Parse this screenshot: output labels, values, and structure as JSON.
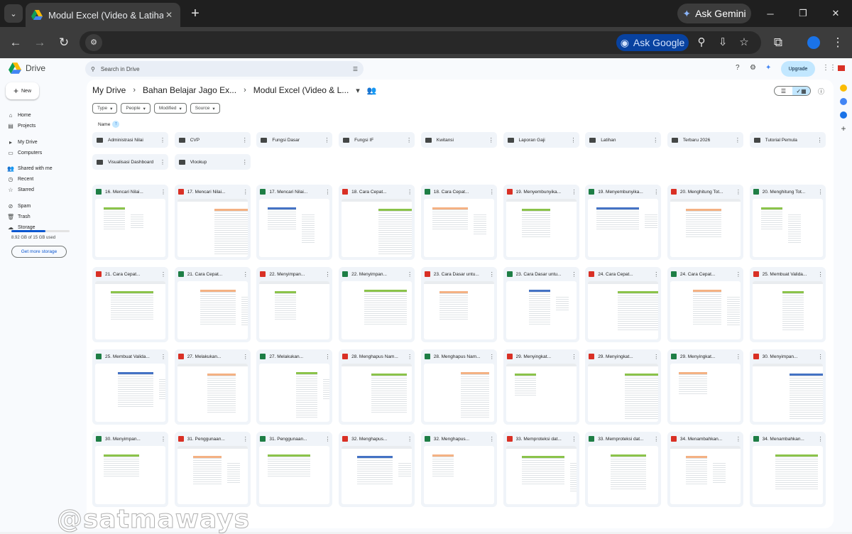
{
  "browser": {
    "tab_title": "Modul Excel (Video & Latihan S",
    "ask_gemini": "Ask Gemini",
    "ask_google": "Ask Google"
  },
  "drive": {
    "brand": "Drive",
    "new_label": "New",
    "search_placeholder": "Search in Drive",
    "upgrade": "Upgrade",
    "nav": [
      {
        "label": "Home",
        "icon": "home-icon"
      },
      {
        "label": "Projects",
        "icon": "projects-icon"
      },
      {
        "label": "My Drive",
        "icon": "my-drive-icon"
      },
      {
        "label": "Computers",
        "icon": "computers-icon"
      },
      {
        "label": "Shared with me",
        "icon": "shared-icon"
      },
      {
        "label": "Recent",
        "icon": "recent-icon"
      },
      {
        "label": "Starred",
        "icon": "star-icon"
      },
      {
        "label": "Spam",
        "icon": "spam-icon"
      },
      {
        "label": "Trash",
        "icon": "trash-icon"
      },
      {
        "label": "Storage",
        "icon": "cloud-icon"
      }
    ],
    "storage_used": "8.92 GB of 15 GB used",
    "storage_fraction": 0.59,
    "get_storage": "Get more storage",
    "breadcrumb": [
      "My Drive",
      "Bahan Belajar Jago Ex...",
      "Modul Excel (Video & L..."
    ],
    "filters": [
      "Type",
      "People",
      "Modified",
      "Source"
    ],
    "sort_label": "Name",
    "folders": [
      "Administrasi Nilai",
      "CVP",
      "Fungsi Dasar",
      "Fungsi IF",
      "Kwitansi",
      "Laporan Gaji",
      "Latihan",
      "Terbaru 2026",
      "Tutorial Pemula",
      "Visualisasi Dashboard",
      "Vlookup"
    ],
    "files": [
      {
        "name": "16. Mencari Nilai...",
        "type": "x"
      },
      {
        "name": "17. Mencari Nilai...",
        "type": "v"
      },
      {
        "name": "17. Mencari Nilai...",
        "type": "x"
      },
      {
        "name": "18. Cara Cepat...",
        "type": "v"
      },
      {
        "name": "18. Cara Cepat...",
        "type": "x"
      },
      {
        "name": "19. Menyembunyika...",
        "type": "v"
      },
      {
        "name": "19. Menyembunyika...",
        "type": "x"
      },
      {
        "name": "20. Menghitung Tot...",
        "type": "v"
      },
      {
        "name": "20. Menghitung Tot...",
        "type": "x"
      },
      {
        "name": "21. Cara Cepat...",
        "type": "v"
      },
      {
        "name": "21. Cara Cepat...",
        "type": "x"
      },
      {
        "name": "22. Menyimpan...",
        "type": "v"
      },
      {
        "name": "22. Menyimpan...",
        "type": "x"
      },
      {
        "name": "23. Cara Dasar untu...",
        "type": "v"
      },
      {
        "name": "23. Cara Dasar untu...",
        "type": "x"
      },
      {
        "name": "24. Cara Cepat...",
        "type": "v"
      },
      {
        "name": "24. Cara Cepat...",
        "type": "x"
      },
      {
        "name": "25. Membuat Valida...",
        "type": "v"
      },
      {
        "name": "25. Membuat Valida...",
        "type": "x"
      },
      {
        "name": "27. Melakukan...",
        "type": "v"
      },
      {
        "name": "27. Melakukan...",
        "type": "x"
      },
      {
        "name": "28. Menghapus Nam...",
        "type": "v"
      },
      {
        "name": "28. Menghapus Nam...",
        "type": "x"
      },
      {
        "name": "29. Menyingkat...",
        "type": "v"
      },
      {
        "name": "29. Menyingkat...",
        "type": "v"
      },
      {
        "name": "29. Menyingkat...",
        "type": "x"
      },
      {
        "name": "30. Menyimpan...",
        "type": "v"
      },
      {
        "name": "30. Menyimpan...",
        "type": "x"
      },
      {
        "name": "31. Penggunaan...",
        "type": "v"
      },
      {
        "name": "31. Penggunaan...",
        "type": "x"
      },
      {
        "name": "32. Menghapus...",
        "type": "v"
      },
      {
        "name": "32. Menghapus...",
        "type": "x"
      },
      {
        "name": "33. Memproteksi dat...",
        "type": "v"
      },
      {
        "name": "33. Memproteksi dat...",
        "type": "x"
      },
      {
        "name": "34. Menambahkan...",
        "type": "v"
      },
      {
        "name": "34. Menambahkan...",
        "type": "x"
      }
    ],
    "watermark": "@satmaways",
    "colors": {
      "accent": "#0b57d0",
      "excel": "#1e7e45",
      "video": "#d93025",
      "sheet_green": "#8bc34a"
    }
  }
}
